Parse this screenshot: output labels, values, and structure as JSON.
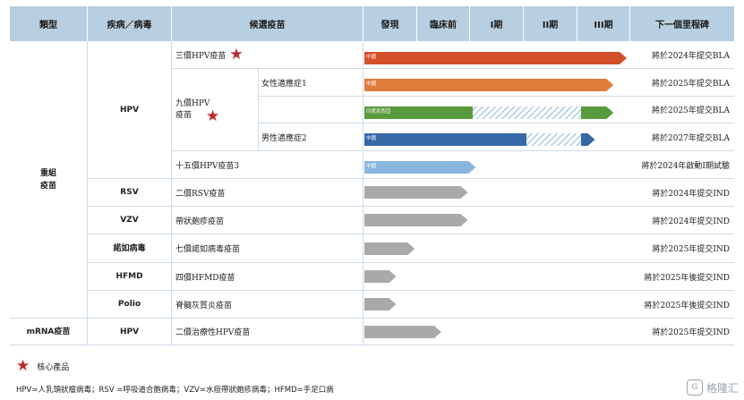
{
  "header": {
    "type": "類型",
    "disease": "疾病／病毒",
    "candidate": "候選疫苗",
    "discovery": "發現",
    "preclinical": "臨床前",
    "phase1": "I期",
    "phase2": "II期",
    "phase3": "III期",
    "milestone": "下一個里程碑"
  },
  "categories": {
    "recombinant": "重組\n疫苗",
    "mrna": "mRNA疫苗"
  },
  "diseases": [
    "HPV",
    "RSV",
    "VZV",
    "諾如病毒",
    "HFMD",
    "Polio",
    "HPV"
  ],
  "rows": [
    {
      "vaccine": "三價HPV疫苗",
      "sub": "",
      "region": "中國",
      "progress": 0.99,
      "milestone": "將於2024年提交BLA"
    },
    {
      "vaccine": "九價HPV\n疫苗",
      "sub": "女性適應症1",
      "region": "中國",
      "progress": 0.94,
      "milestone": "將於2025年提交BLA"
    },
    {
      "vaccine": "",
      "sub": "",
      "region": "印度尼西亞",
      "progress": 0.94,
      "milestone": "將於2025年提交BLA"
    },
    {
      "vaccine": "",
      "sub": "男性適應症2",
      "region": "中國",
      "progress": 0.87,
      "milestone": "將於2027年提交BLA"
    },
    {
      "vaccine": "十五價HPV疫苗3",
      "sub": "",
      "region": "中國",
      "progress": 0.42,
      "milestone": "將於2024年啟動I期試驗"
    },
    {
      "vaccine": "二價RSV疫苗",
      "sub": "",
      "region": "",
      "progress": 0.39,
      "milestone": "將於2024年提交IND"
    },
    {
      "vaccine": "帶狀皰疹疫苗",
      "sub": "",
      "region": "",
      "progress": 0.39,
      "milestone": "將於2024年提交IND"
    },
    {
      "vaccine": "七價諾如病毒疫苗",
      "sub": "",
      "region": "",
      "progress": 0.19,
      "milestone": "將於2025年提交IND"
    },
    {
      "vaccine": "四價HFMD疫苗",
      "sub": "",
      "region": "",
      "progress": 0.12,
      "milestone": "將於2025年後提交IND"
    },
    {
      "vaccine": "脊髓灰質炎疫苗",
      "sub": "",
      "region": "",
      "progress": 0.12,
      "milestone": "將於2025年後提交IND"
    },
    {
      "vaccine": "二價治療性HPV疫苗",
      "sub": "",
      "region": "",
      "progress": 0.29,
      "milestone": "將於2025年提交IND"
    }
  ],
  "legend": {
    "label": "核心產品"
  },
  "footnote": "HPV=人乳頭狀瘤病毒；RSV =呼吸道合胞病毒；VZV=水痘帶狀皰疹病毒；HFMD=手足口病",
  "watermark": "格隆汇",
  "colors": {
    "header": "#b7cfe0",
    "red": "#d4502a",
    "orange": "#e07d3c",
    "green": "#5a9a3e",
    "blue": "#3569a8",
    "lightblue": "#8ab6dd",
    "gray": "#a9a9a9",
    "star": "#c0272d"
  }
}
